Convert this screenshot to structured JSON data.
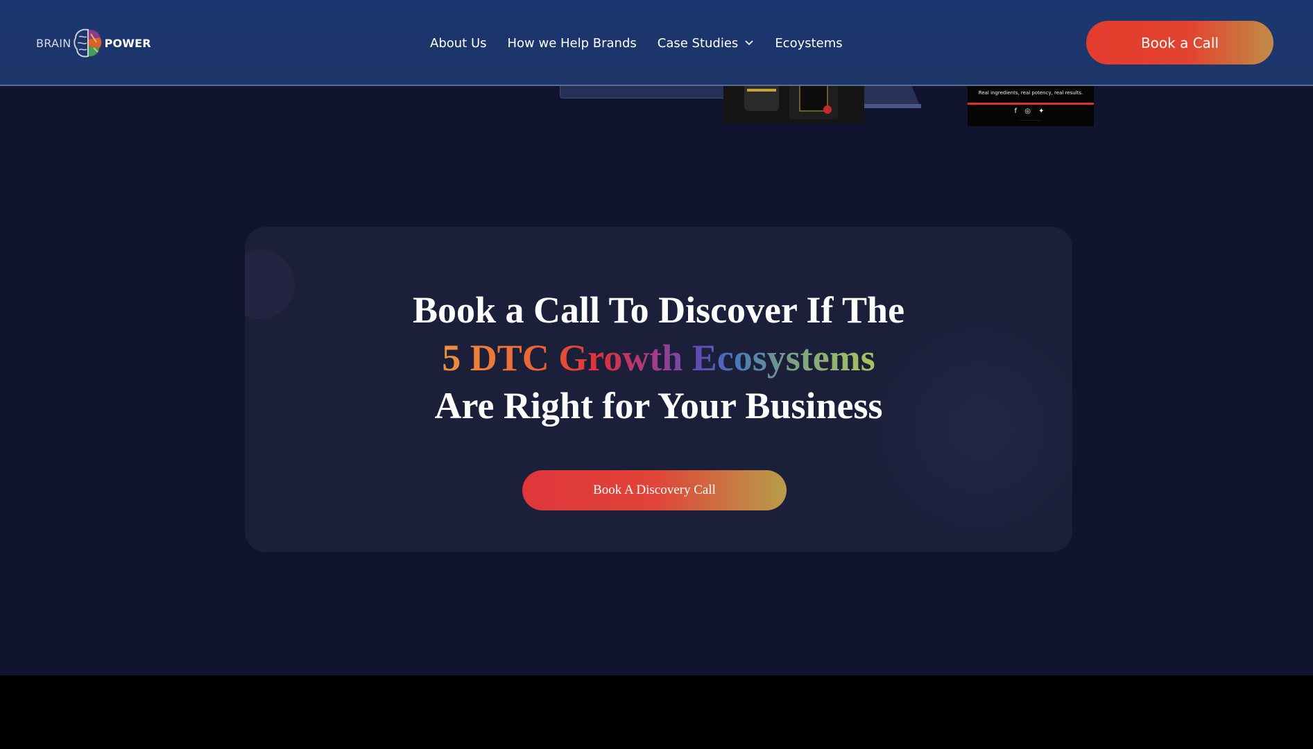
{
  "header": {
    "logo": {
      "left_text": "BRAIN",
      "right_text": "POWER"
    },
    "nav": [
      {
        "label": "About Us"
      },
      {
        "label": "How we Help Brands"
      },
      {
        "label": "Case Studies",
        "has_dropdown": true
      },
      {
        "label": "Ecoystems"
      }
    ],
    "cta_label": "Book a Call"
  },
  "peek": {
    "footer_tagline": "Real ingredients, real potency, real results.",
    "footer_social": "f ◎ ✦"
  },
  "cta_section": {
    "headline_line1": "Book a Call To Discover If The",
    "headline_highlight": "5 DTC Growth Ecosystems",
    "headline_line3": "Are Right for Your Business",
    "button_label": "Book A Discovery Call"
  },
  "colors": {
    "header_bg": "#1c3670",
    "page_bg": "#11142e",
    "card_bg": "#1c1f3a",
    "accent_red": "#e43b2e",
    "accent_gold": "#c18c47"
  }
}
